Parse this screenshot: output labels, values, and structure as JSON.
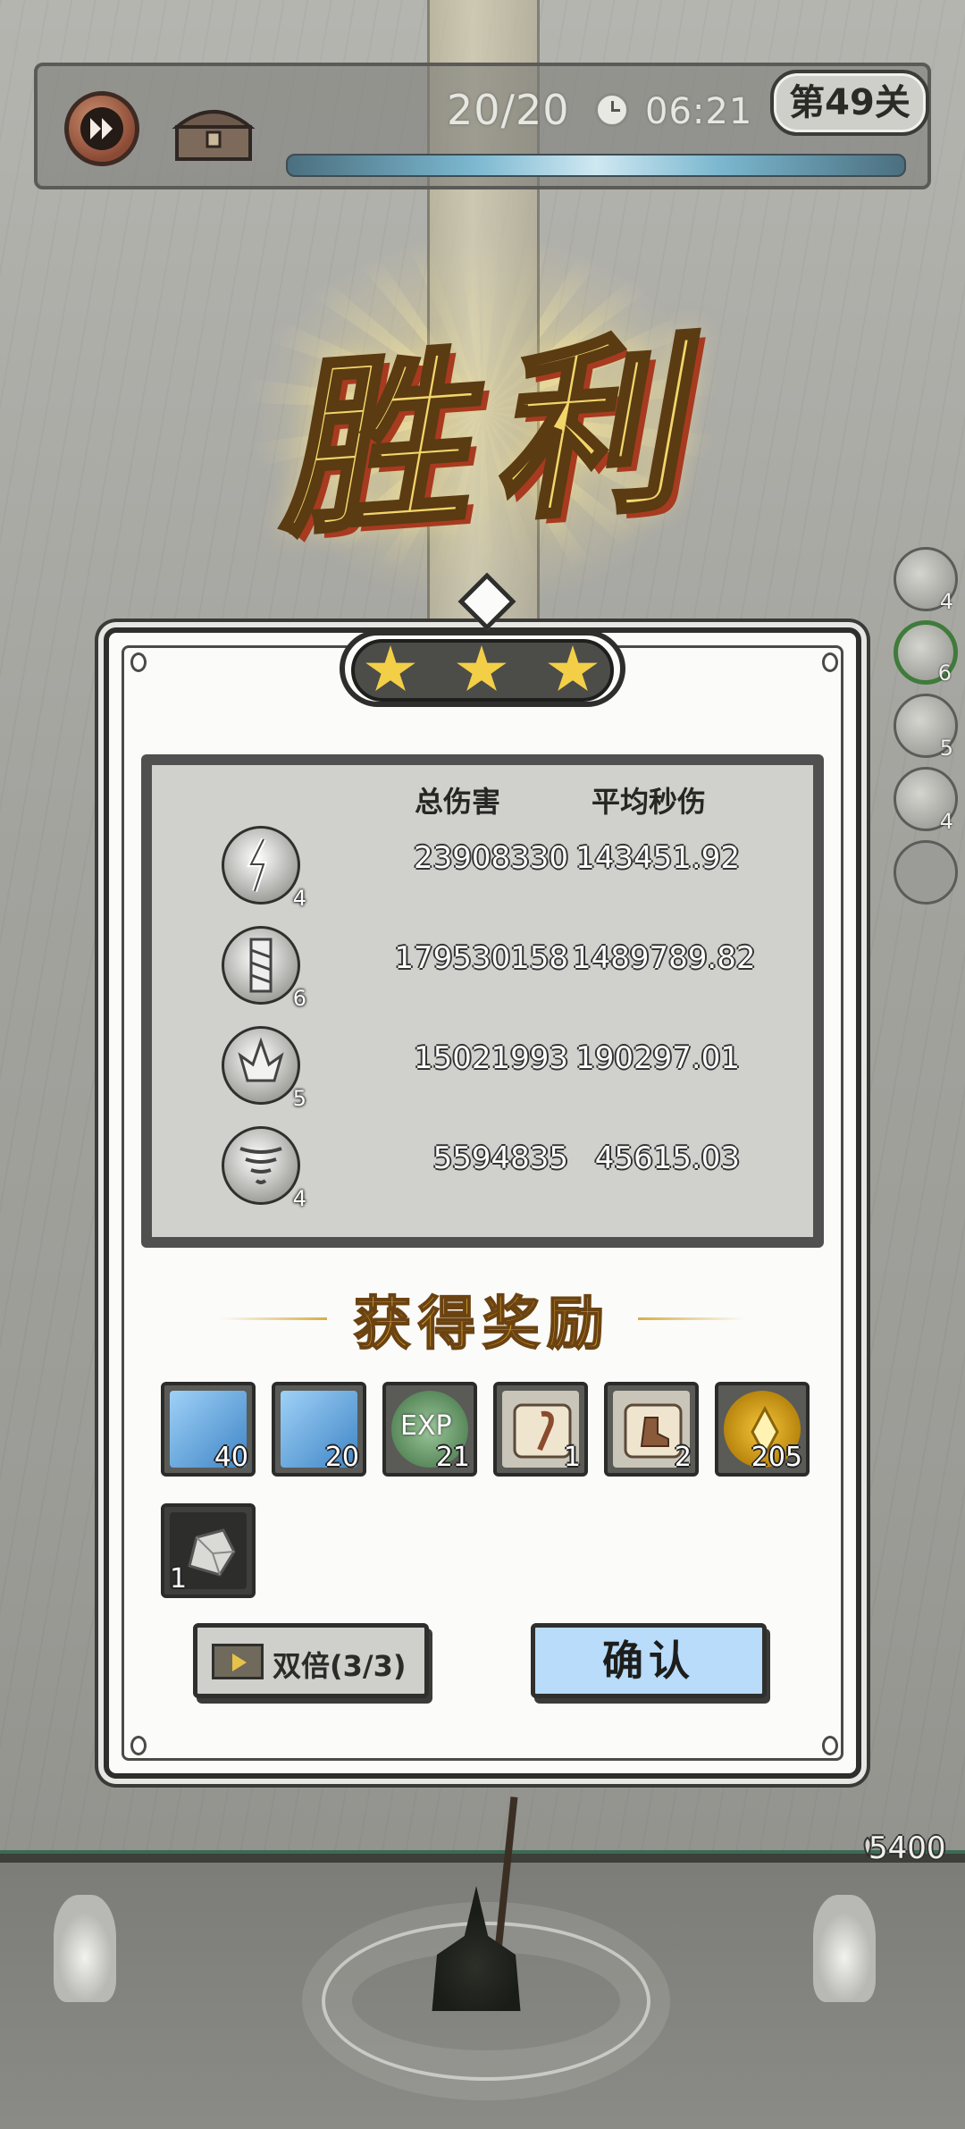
{
  "hud": {
    "wave": "20/20",
    "timer": "06:21",
    "level": "第49关"
  },
  "victory_text": "胜利",
  "side_skills": [
    {
      "icon": "lightning-skill-icon",
      "level": "4"
    },
    {
      "icon": "drill-skill-icon",
      "level": "6"
    },
    {
      "icon": "crystal-skill-icon",
      "level": "5"
    },
    {
      "icon": "tornado-skill-icon",
      "level": "4"
    },
    {
      "icon": "empty-skill-slot",
      "level": ""
    }
  ],
  "stars": 3,
  "stats": {
    "headers": {
      "total_damage": "总伤害",
      "avg_dps": "平均秒伤"
    },
    "rows": [
      {
        "icon": "lightning-skill-icon",
        "level": "4",
        "total": "23908330",
        "dps": "143451.92"
      },
      {
        "icon": "drill-skill-icon",
        "level": "6",
        "total": "179530158",
        "dps": "1489789.82"
      },
      {
        "icon": "crystal-skill-icon",
        "level": "5",
        "total": "15021993",
        "dps": "190297.01"
      },
      {
        "icon": "tornado-skill-icon",
        "level": "4",
        "total": "5594835",
        "dps": "45615.03"
      }
    ]
  },
  "rewards": {
    "title": "获得奖励",
    "items": [
      {
        "icon": "tornado-card-icon",
        "count": "40",
        "color": "#5ea7e4"
      },
      {
        "icon": "drill-card-icon",
        "count": "20",
        "color": "#5ea7e4"
      },
      {
        "icon": "exp-orb-icon",
        "label": "EXP",
        "count": "21",
        "color": "#4f8a52"
      },
      {
        "icon": "scroll-staff-icon",
        "count": "1",
        "color": "#e9dcc0"
      },
      {
        "icon": "scroll-boot-icon",
        "count": "2",
        "color": "#e9dcc0"
      },
      {
        "icon": "gold-coin-icon",
        "count": "205",
        "color": "#d9a516"
      },
      {
        "icon": "ore-stone-icon",
        "count": "1",
        "color": "#3f3f3c"
      }
    ]
  },
  "buttons": {
    "double": "双倍(3/3)",
    "confirm": "确认"
  },
  "battle": {
    "gold": "5400"
  }
}
